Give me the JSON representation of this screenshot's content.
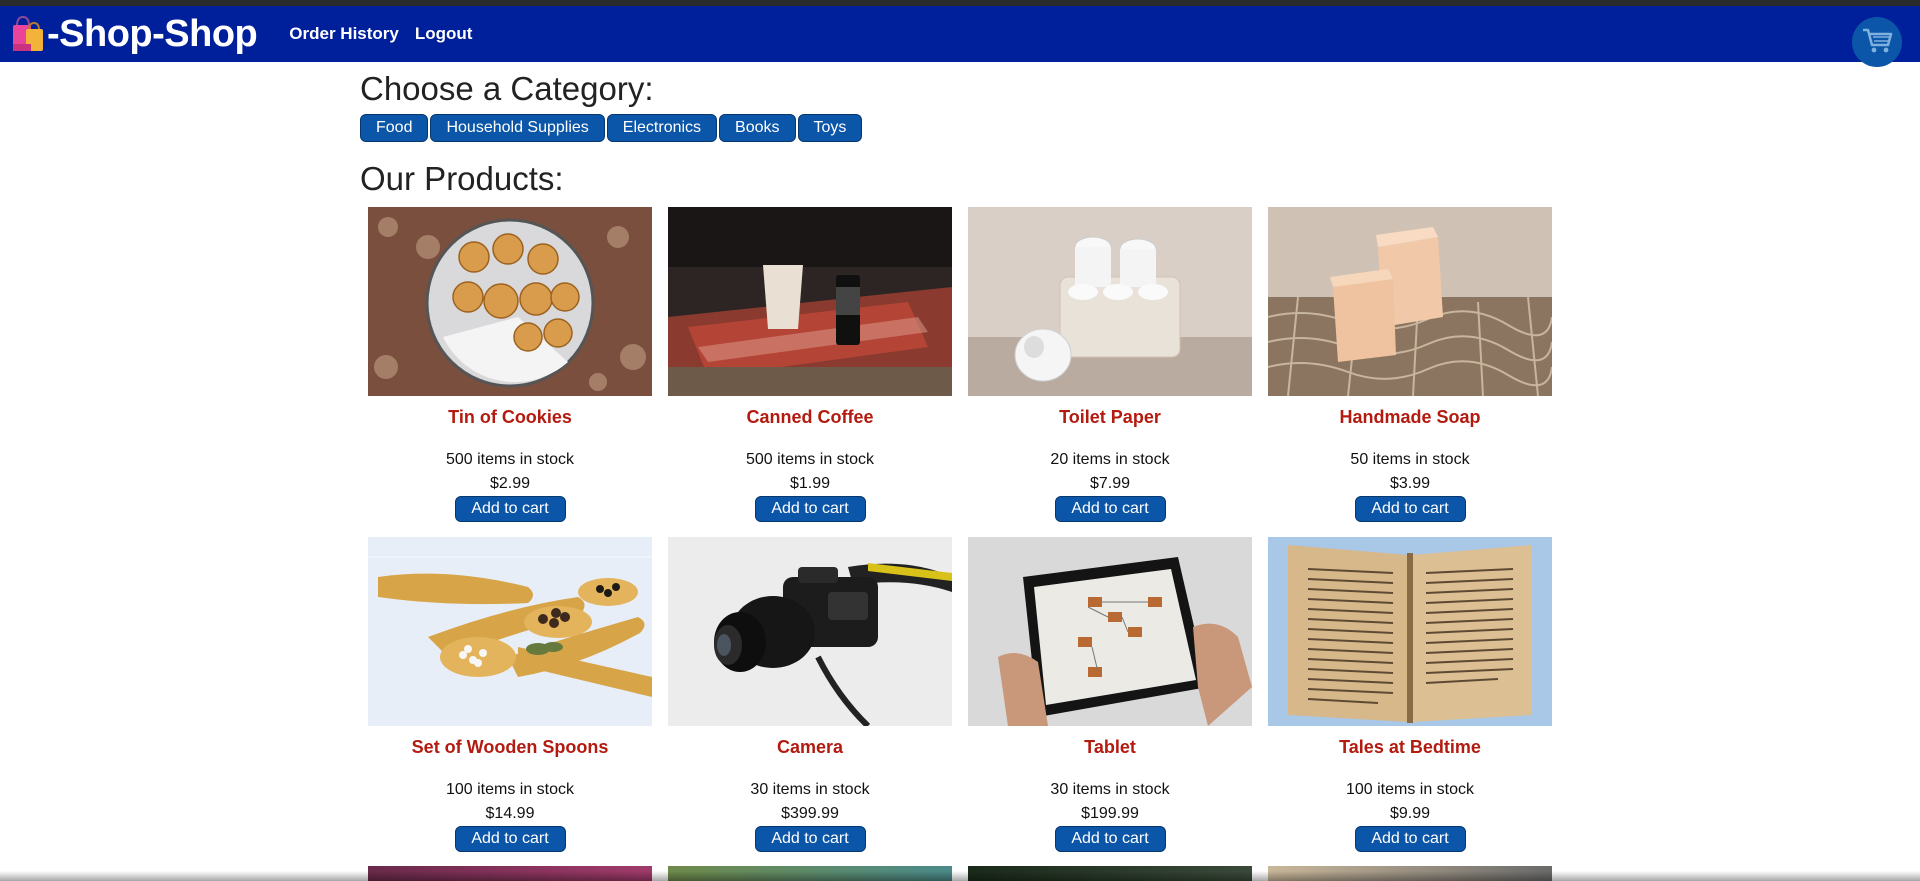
{
  "brand": {
    "title": "-Shop-Shop",
    "icon": "shopping-bags-icon"
  },
  "nav": {
    "order_history": "Order History",
    "logout": "Logout"
  },
  "cart": {
    "icon": "cart-icon"
  },
  "categories": {
    "heading": "Choose a Category:",
    "items": [
      "Food",
      "Household Supplies",
      "Electronics",
      "Books",
      "Toys"
    ]
  },
  "products": {
    "heading": "Our Products:",
    "add_label": "Add to cart",
    "items": [
      {
        "name": "Tin of Cookies",
        "stock": "500 items in stock",
        "price": "$2.99"
      },
      {
        "name": "Canned Coffee",
        "stock": "500 items in stock",
        "price": "$1.99"
      },
      {
        "name": "Toilet Paper",
        "stock": "20 items in stock",
        "price": "$7.99"
      },
      {
        "name": "Handmade Soap",
        "stock": "50 items in stock",
        "price": "$3.99"
      },
      {
        "name": "Set of Wooden Spoons",
        "stock": "100 items in stock",
        "price": "$14.99"
      },
      {
        "name": "Camera",
        "stock": "30 items in stock",
        "price": "$399.99"
      },
      {
        "name": "Tablet",
        "stock": "30 items in stock",
        "price": "$199.99"
      },
      {
        "name": "Tales at Bedtime",
        "stock": "100 items in stock",
        "price": "$9.99"
      }
    ]
  },
  "colors": {
    "navbar": "#00209b",
    "button": "#0b56a8",
    "product_name": "#b31b10"
  }
}
